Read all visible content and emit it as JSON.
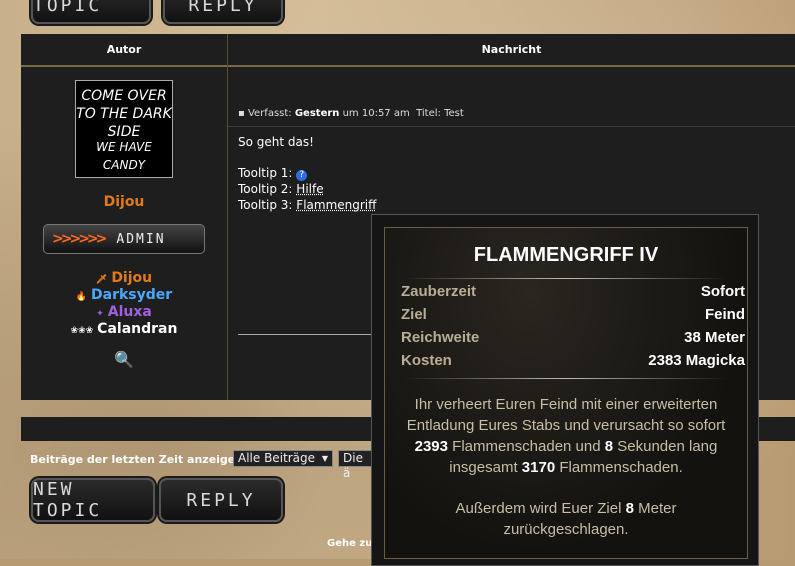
{
  "buttons": {
    "new_topic": "NEW TOPIC",
    "reply": "REPLY"
  },
  "table": {
    "col_author": "Autor",
    "col_message": "Nachricht"
  },
  "author": {
    "avatar_line1": "COME OVER TO THE DARK SIDE",
    "avatar_line2": "WE HAVE CANDY",
    "name": "Dijou",
    "rank": "ADMIN",
    "rank_arrows": ">>>>>>",
    "groups": [
      {
        "name": "Dijou",
        "color": "#e07a1a"
      },
      {
        "name": "Darksyder",
        "color": "#4aa8ff"
      },
      {
        "name": "Aluxa",
        "color": "#a060e0"
      },
      {
        "name": "Calandran",
        "color": "#ffffff"
      }
    ]
  },
  "post": {
    "meta_prefix": "Verfasst:",
    "meta_day": "Gestern",
    "meta_time": "um 10:57 am",
    "meta_title_label": "Titel:",
    "meta_title": "Test",
    "line1": "So geht das!",
    "tt1_label": "Tooltip 1:",
    "tt2_label": "Tooltip 2:",
    "tt2_value": "Hilfe",
    "tt3_label": "Tooltip 3:",
    "tt3_value": "Flammengriff"
  },
  "footer": {
    "show_label": "Beiträge der letzten Zeit anzeigen:",
    "select1": "Alle Beiträge",
    "select2": "Die ä",
    "jump_label": "Gehe zu"
  },
  "tooltip": {
    "title": "FLAMMENGRIFF IV",
    "rows": [
      {
        "k": "Zauberzeit",
        "v": "Sofort"
      },
      {
        "k": "Ziel",
        "v": "Feind"
      },
      {
        "k": "Reichweite",
        "v": "38 Meter"
      },
      {
        "k": "Kosten",
        "v": "2383 Magicka"
      }
    ],
    "desc_a1": "Ihr verheert Euren Feind mit einer erweiterten",
    "desc_a2": "Entladung Eures Stabs und verursacht so sofort",
    "desc_a3_n1": "2393",
    "desc_a3_t1": " Flammenschaden und ",
    "desc_a3_n2": "8",
    "desc_a3_t2": " Sekunden lang",
    "desc_a4_t1": "insgesamt ",
    "desc_a4_n1": "3170",
    "desc_a4_t2": " Flammenschaden.",
    "desc_b1_t1": "Außerdem wird Euer Ziel ",
    "desc_b1_n1": "8",
    "desc_b1_t2": " Meter",
    "desc_b2": "zurückgeschlagen."
  },
  "colors": {
    "accent": "#e07a1a",
    "header_line": "#7a6a46"
  }
}
